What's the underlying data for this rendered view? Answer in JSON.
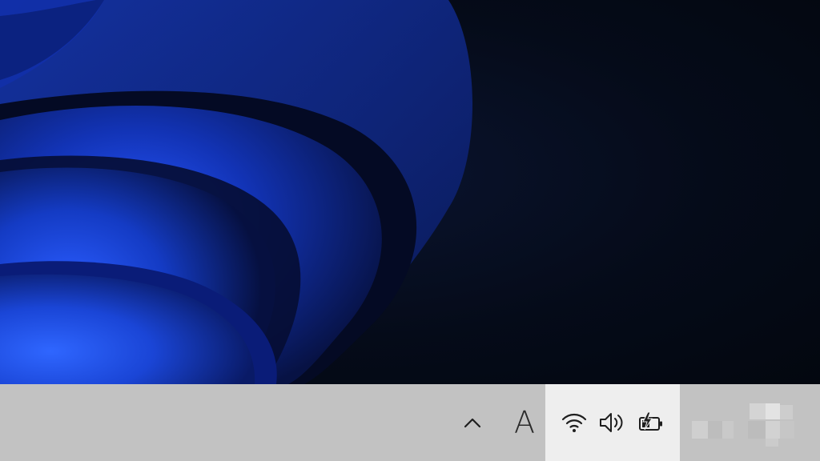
{
  "taskbar": {
    "ime_label": "A",
    "icons": {
      "overflow": "chevron-up-icon",
      "wifi": "wifi-icon",
      "volume": "speaker-icon",
      "battery": "battery-charging-icon"
    }
  },
  "colors": {
    "taskbar_bg": "#c2c2c2",
    "quick_settings_bg": "#eeeeee",
    "wallpaper_blue": "#1a3fd1",
    "wallpaper_dark": "#050b17"
  }
}
